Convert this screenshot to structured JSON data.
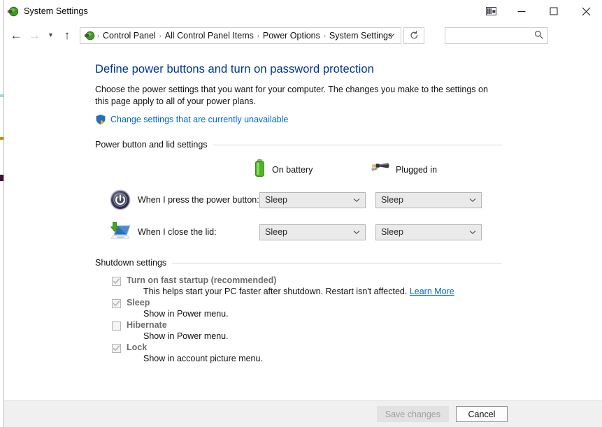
{
  "window": {
    "title": "System Settings",
    "app_icon": "power-options-icon",
    "caption": {
      "ribbon": "ribbon-options-icon",
      "minimize": "minimize-icon",
      "maximize": "maximize-icon",
      "close": "close-icon"
    }
  },
  "nav": {
    "back": "back-arrow-icon",
    "forward": "forward-arrow-icon",
    "recent": "recent-pages-chevron-icon",
    "up": "up-arrow-icon",
    "address_icon": "power-options-icon",
    "breadcrumbs": [
      "Control Panel",
      "All Control Panel Items",
      "Power Options",
      "System Settings"
    ],
    "separator": "›",
    "dropdown": "chevron-down-icon",
    "refresh": "refresh-icon",
    "search_placeholder": "",
    "search_value": "",
    "search_icon": "search-icon"
  },
  "page": {
    "title": "Define power buttons and turn on password protection",
    "description": "Choose the power settings that you want for your computer. The changes you make to the settings on this page apply to all of your power plans.",
    "uac_icon": "uac-shield-icon",
    "uac_link": "Change settings that are currently unavailable"
  },
  "power_section": {
    "label": "Power button and lid settings",
    "columns": [
      {
        "label": "On battery",
        "icon": "battery-icon"
      },
      {
        "label": "Plugged in",
        "icon": "power-plug-icon"
      }
    ],
    "rows": [
      {
        "icon": "power-button-icon",
        "label": "When I press the power button:",
        "on_battery": "Sleep",
        "plugged_in": "Sleep"
      },
      {
        "icon": "laptop-lid-icon",
        "label": "When I close the lid:",
        "on_battery": "Sleep",
        "plugged_in": "Sleep"
      }
    ],
    "dropdown_arrow": "chevron-down-icon"
  },
  "shutdown_section": {
    "label": "Shutdown settings",
    "items": [
      {
        "label": "Turn on fast startup (recommended)",
        "checked": true,
        "desc_before": "This helps start your PC faster after shutdown. Restart isn't affected. ",
        "link": "Learn More"
      },
      {
        "label": "Sleep",
        "checked": true,
        "desc_before": "Show in Power menu.",
        "link": ""
      },
      {
        "label": "Hibernate",
        "checked": false,
        "desc_before": "Show in Power menu.",
        "link": ""
      },
      {
        "label": "Lock",
        "checked": true,
        "desc_before": "Show in account picture menu.",
        "link": ""
      }
    ]
  },
  "footer": {
    "save_label": "Save changes",
    "save_disabled": true,
    "cancel_label": "Cancel"
  },
  "colors": {
    "heading_blue": "#003399",
    "link_blue": "#0066cc",
    "battery_green": "#4caf24",
    "footer_bg": "#f0f0f0",
    "dropdown_bg": "#eaeaea"
  }
}
